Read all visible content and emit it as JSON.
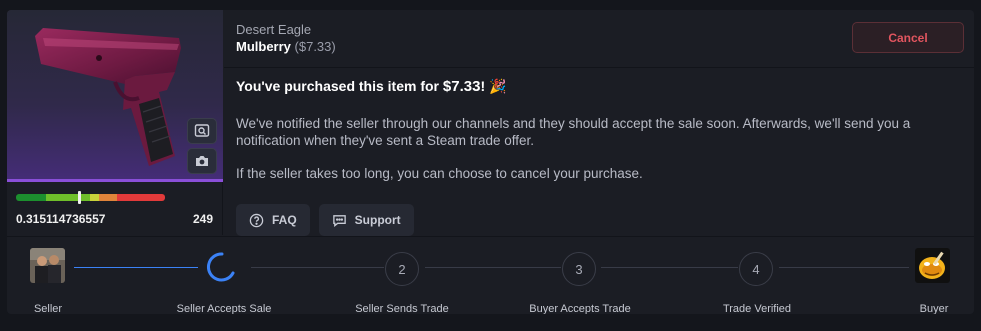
{
  "item": {
    "type": "Desert Eagle",
    "name": "Mulberry",
    "price": "($7.33)",
    "float": "0.315114736557",
    "pattern": "249",
    "wear_position": 0.42
  },
  "actions": {
    "cancel_label": "Cancel",
    "inspect_icon": "inspect-icon",
    "screenshot_icon": "camera-icon"
  },
  "message": {
    "headline_prefix": "You've purchased this item for ",
    "headline_price": "$7.33",
    "headline_suffix": "!",
    "headline_emoji": "🎉",
    "paragraph1": "We've notified the seller through our channels and they should accept the sale soon. Afterwards, we'll send you a notification when they've sent a Steam trade offer.",
    "paragraph2": "If the seller takes too long, you can choose to cancel your purchase."
  },
  "links": [
    {
      "label": "FAQ",
      "icon": "help-circle-icon"
    },
    {
      "label": "Support",
      "icon": "chat-icon"
    }
  ],
  "steps": [
    {
      "label": "Seller",
      "kind": "avatar"
    },
    {
      "label": "Seller Accepts Sale",
      "kind": "loading"
    },
    {
      "label": "Seller Sends Trade",
      "number": "2"
    },
    {
      "label": "Buyer Accepts Trade",
      "number": "3"
    },
    {
      "label": "Trade Verified",
      "number": "4"
    },
    {
      "label": "Buyer",
      "kind": "avatar"
    }
  ],
  "colors": {
    "accent": "#3b82f6",
    "cancel": "#e2555f",
    "item_glow": "#8a4fd8"
  }
}
